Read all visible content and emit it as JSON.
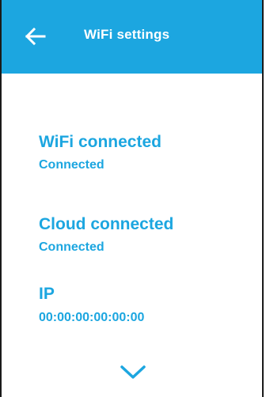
{
  "header": {
    "title": "WiFi settings",
    "back_icon": "arrow-left-icon"
  },
  "sections": [
    {
      "title": "WiFi connected",
      "value": "Connected"
    },
    {
      "title": "Cloud connected",
      "value": "Connected"
    },
    {
      "title": "IP",
      "value": "00:00:00:00:00:00"
    }
  ],
  "footer": {
    "more_icon": "chevron-down-icon"
  },
  "colors": {
    "accent": "#1ca6e0",
    "header_text": "#ffffff",
    "background": "#ffffff"
  }
}
